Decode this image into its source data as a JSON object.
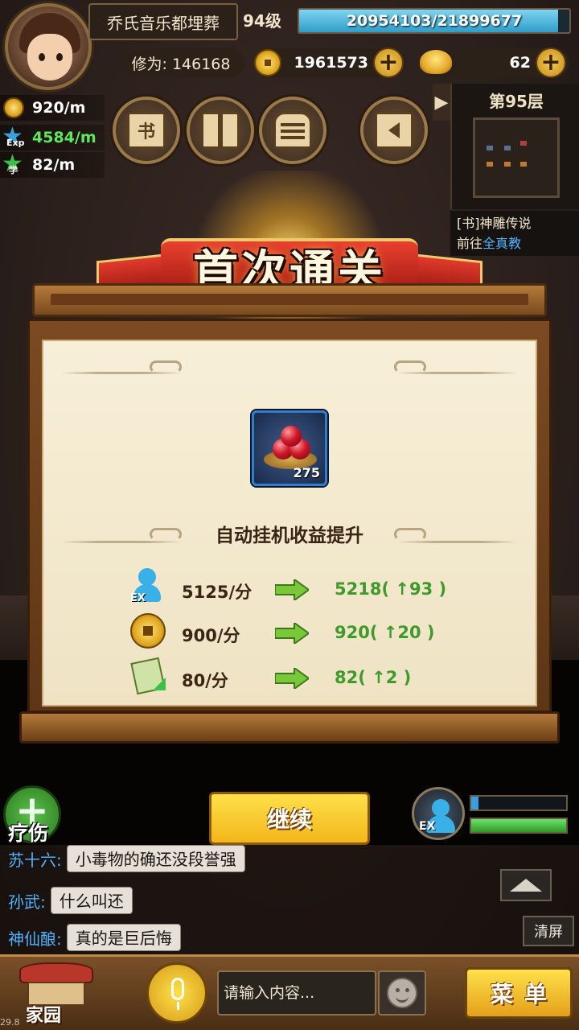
{
  "player": {
    "name": "乔氏音乐都埋葬",
    "level": "94级",
    "exp_text": "20954103/21899677",
    "exp_fraction": 0.957,
    "cultivation": "修为: 146168",
    "coins": "1961573",
    "ingots": "62"
  },
  "rates": {
    "coin_rate": "920/m",
    "exp_rate": "4584/m",
    "exp_label": "Exp",
    "study_rate": "82/m",
    "study_label": "学"
  },
  "toolbar": {
    "book_glyph": "书"
  },
  "minimap": {
    "floor": "第95层"
  },
  "quest": {
    "title": "[书]神雕传说",
    "prefix": "前往",
    "target": "全真教"
  },
  "reward": {
    "banner": "首次通关",
    "item_count": "275",
    "subtitle": "自动挂机收益提升",
    "rows": [
      {
        "old": "5125/分",
        "new": "5218( ↑93 )",
        "icon": "exp-person-icon"
      },
      {
        "old": "900/分",
        "new": "920( ↑20 )",
        "icon": "coin-icon"
      },
      {
        "old": "80/分",
        "new": "82( ↑2 )",
        "icon": "scroll-icon"
      }
    ]
  },
  "actions": {
    "heal": "疗伤",
    "continue": "继续",
    "exp_tag": "EX",
    "bar_blue_fraction": 0.08,
    "bar_green_fraction": 1.0
  },
  "chat": {
    "messages": [
      {
        "name": "苏十六:",
        "text": "小毒物的确还没段誉强"
      },
      {
        "name": "孙武:",
        "text": "什么叫还"
      },
      {
        "name": "神仙酿:",
        "text": "真的是巨后悔"
      }
    ],
    "clear": "清屏",
    "input_placeholder": "请输入内容...",
    "home": "家园",
    "menu": "菜单"
  },
  "debug": {
    "fps": "29.8"
  },
  "colors": {
    "gain_green": "#3e9a2a",
    "chat_name_blue": "#4fb3ff",
    "item_border_blue": "#2f7fd0",
    "exp_green": "#5ee85a"
  }
}
